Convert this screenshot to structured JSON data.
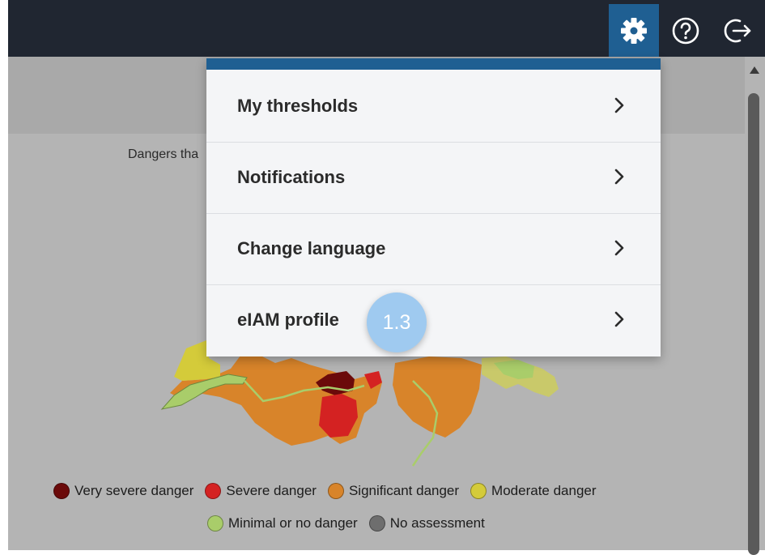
{
  "header": {
    "settings_icon": "gear-icon",
    "help_icon": "help-circle-icon",
    "logout_icon": "logout-icon",
    "active_color": "#1f5f92"
  },
  "map": {
    "title": "Dangers tha"
  },
  "legend": {
    "items": [
      {
        "label": "Very severe danger",
        "color": "#6b0a0a"
      },
      {
        "label": "Severe danger",
        "color": "#d42222"
      },
      {
        "label": "Significant danger",
        "color": "#d8842a"
      },
      {
        "label": "Moderate danger",
        "color": "#d4cb3a"
      },
      {
        "label": "Minimal or no danger",
        "color": "#a9cd6a"
      },
      {
        "label": "No assessment",
        "color": "#6e6e6e"
      }
    ]
  },
  "settings_menu": {
    "items": [
      {
        "label": "My thresholds"
      },
      {
        "label": "Notifications"
      },
      {
        "label": "Change language"
      },
      {
        "label": "eIAM profile"
      }
    ],
    "chevron_icon": "chevron-right-icon"
  },
  "step_badge": {
    "label": "1.3",
    "color": "#9fcaf0"
  }
}
